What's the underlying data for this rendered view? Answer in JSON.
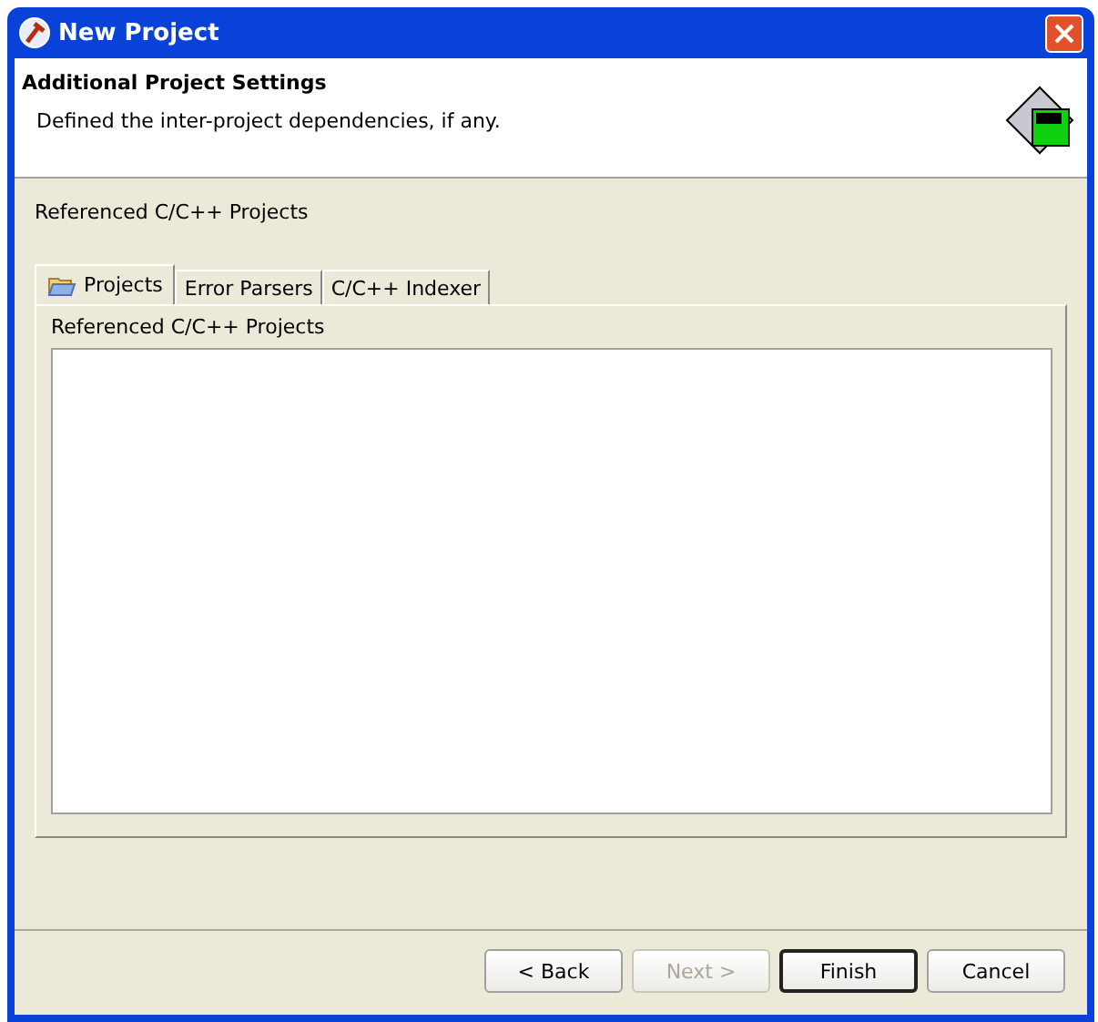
{
  "window": {
    "title": "New Project"
  },
  "header": {
    "title": "Additional Project Settings",
    "description": "Defined the inter-project dependencies, if any."
  },
  "section_label": "Referenced C/C++ Projects",
  "tabs": [
    {
      "label": "Projects",
      "selected": true,
      "icon": true
    },
    {
      "label": "Error Parsers",
      "selected": false,
      "icon": false
    },
    {
      "label": "C/C++ Indexer",
      "selected": false,
      "icon": false
    }
  ],
  "tab_panel": {
    "label": "Referenced C/C++ Projects"
  },
  "buttons": [
    {
      "label": "< Back",
      "disabled": false,
      "default": false
    },
    {
      "label": "Next >",
      "disabled": true,
      "default": false
    },
    {
      "label": "Finish",
      "disabled": false,
      "default": true
    },
    {
      "label": "Cancel",
      "disabled": false,
      "default": false
    }
  ]
}
